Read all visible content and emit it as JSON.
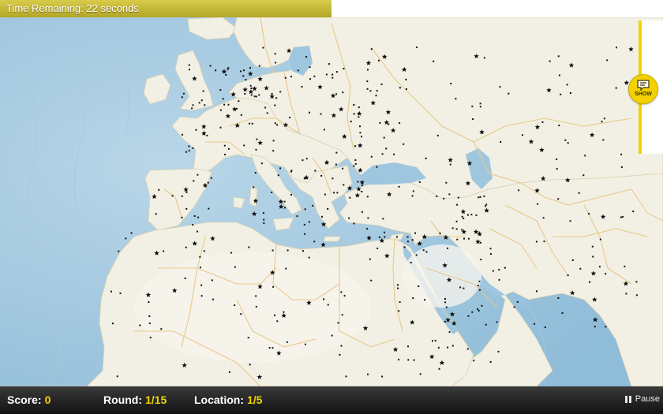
{
  "timer": {
    "text": "Time Remaining: 22 seconds",
    "remaining_fraction": 0.5
  },
  "side_panel": {
    "show_label": "SHOW",
    "show_icon": "hint-bubble-icon"
  },
  "status": {
    "score_label": "Score:",
    "score_value": "0",
    "round_label": "Round:",
    "round_value": "1/15",
    "location_label": "Location:",
    "location_value": "1/5",
    "pause_label": "Pause",
    "pause_icon": "pause-icon"
  },
  "colors": {
    "accent": "#f3d200",
    "timer_fill": "#c4b838",
    "sea": "#9fc6df",
    "land": "#f2f0e4",
    "border": "#e7c98a",
    "status_bar": "#1e1e1e"
  },
  "map": {
    "region": "Europe, North Africa and the Middle East",
    "marker_icons": [
      "city-dot-icon",
      "capital-star-icon"
    ]
  }
}
